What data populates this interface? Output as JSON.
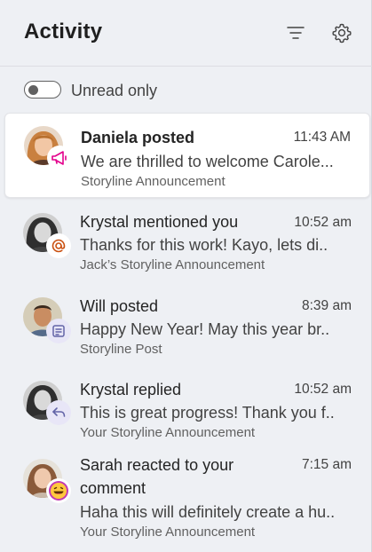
{
  "header": {
    "title": "Activity",
    "filter_icon": "filter-icon",
    "settings_icon": "gear-icon"
  },
  "filter": {
    "unread_only_label": "Unread only",
    "unread_only_on": false
  },
  "colors": {
    "accent": "#6264a7",
    "announcement": "#e3008c",
    "mention": "#ca5010"
  },
  "items": [
    {
      "name": "Daniela posted",
      "time": "11:43 AM",
      "preview": "We are thrilled to welcome Carole...",
      "source": "Storyline Announcement",
      "badge": "megaphone-icon",
      "unread": true
    },
    {
      "name": "Krystal mentioned you",
      "time": "10:52 am",
      "preview": "Thanks for this work! Kayo, lets di..",
      "source": "Jack’s Storyline Announcement",
      "badge": "at-mention-icon",
      "unread": false
    },
    {
      "name": "Will posted",
      "time": "8:39 am",
      "preview": "Happy New Year! May this year br..",
      "source": "Storyline Post",
      "badge": "post-icon",
      "unread": false
    },
    {
      "name": "Krystal replied",
      "time": "10:52 am",
      "preview": "This is great progress! Thank you f..",
      "source": "Your Storyline Announcement",
      "badge": "reply-icon",
      "unread": false
    },
    {
      "name": "Sarah reacted to your",
      "name_line2": "comment",
      "time": "7:15 am",
      "preview": "Haha this will definitely create a hu..",
      "source": "Your Storyline Announcement",
      "badge": "laugh-emoji-icon",
      "unread": false
    }
  ]
}
